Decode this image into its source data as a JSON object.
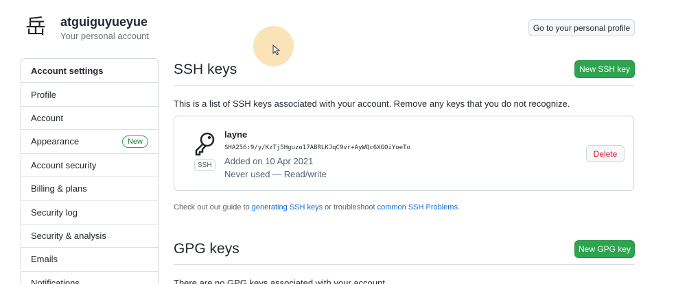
{
  "header": {
    "avatar_glyph": "岳",
    "username": "atguiguyueyue",
    "account_type": "Your personal account",
    "profile_button": "Go to your personal profile"
  },
  "sidebar": {
    "items": [
      {
        "label": "Account settings",
        "heading": true
      },
      {
        "label": "Profile"
      },
      {
        "label": "Account"
      },
      {
        "label": "Appearance",
        "badge": "New"
      },
      {
        "label": "Account security"
      },
      {
        "label": "Billing & plans"
      },
      {
        "label": "Security log"
      },
      {
        "label": "Security & analysis"
      },
      {
        "label": "Emails"
      },
      {
        "label": "Notifications"
      }
    ]
  },
  "ssh": {
    "title": "SSH keys",
    "new_button": "New SSH key",
    "description": "This is a list of SSH keys associated with your account. Remove any keys that you do not recognize.",
    "key": {
      "name": "layne",
      "fingerprint": "SHA256:9/y/KzTj5Hguzo17ABRLKJqC9vr+AyWQc6XGOiYoeTo",
      "tag": "SSH",
      "added": "Added on 10 Apr 2021",
      "usage": "Never used — Read/write",
      "delete_button": "Delete"
    },
    "guide": {
      "prefix": "Check out our guide to ",
      "link1": "generating SSH keys",
      "middle": " or troubleshoot ",
      "link2": "common SSH Problems",
      "suffix": "."
    }
  },
  "gpg": {
    "title": "GPG keys",
    "new_button": "New GPG key",
    "description": "There are no GPG keys associated with your account."
  },
  "colors": {
    "primary_button": "#2da44e",
    "link": "#0969da",
    "danger": "#cf222e",
    "cursor_halo": "#fadaa0"
  }
}
